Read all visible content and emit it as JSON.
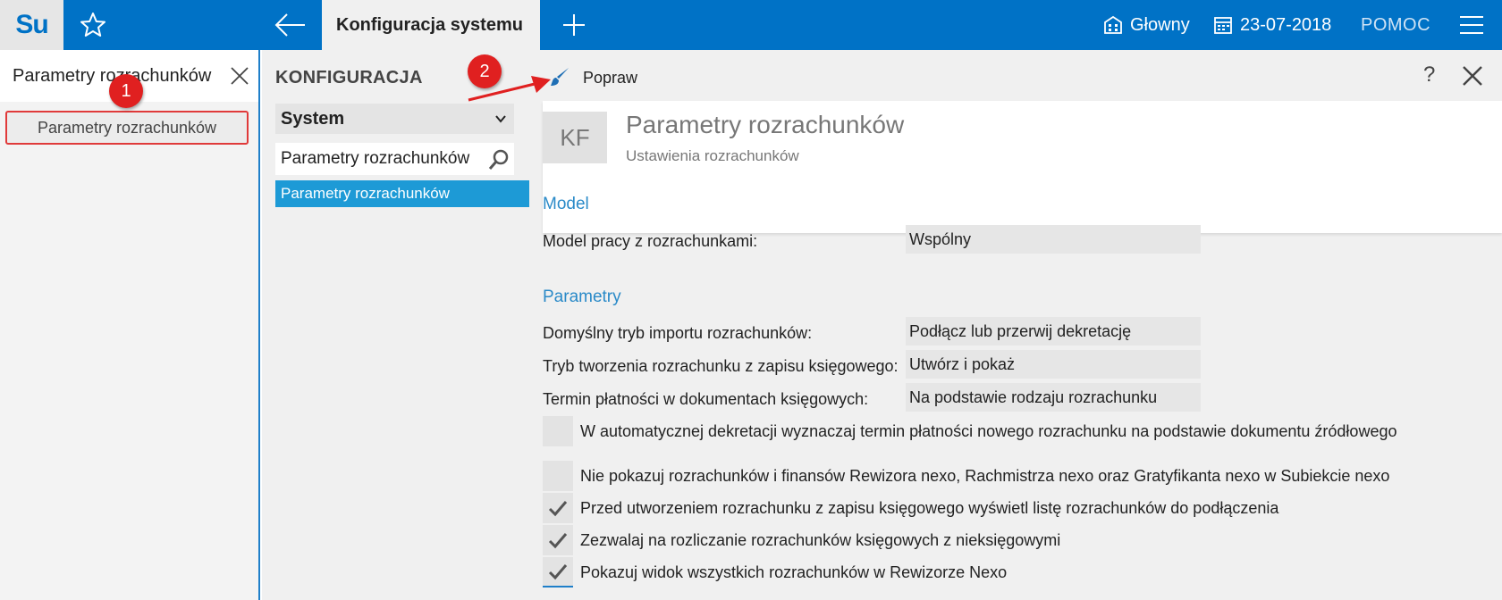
{
  "app": {
    "logo": "Su",
    "active_tab": "Konfiguracja systemu",
    "branch": "Głowny",
    "date": "23-07-2018",
    "help": "POMOC"
  },
  "left_panel": {
    "title": "Parametry rozrachunków",
    "item": "Parametry rozrachunków"
  },
  "middle_panel": {
    "heading": "KONFIGURACJA",
    "select_value": "System",
    "search_value": "Parametry rozrachunków",
    "result": "Parametry rozrachunków"
  },
  "toolbar": {
    "edit_label": "Popraw",
    "help": "?"
  },
  "header": {
    "icon": "KF",
    "title": "Parametry rozrachunków",
    "subtitle": "Ustawienia rozrachunków"
  },
  "sections": {
    "model": "Model",
    "params": "Parametry"
  },
  "fields": [
    {
      "label": "Model pracy z rozrachunkami:",
      "value": "Wspólny"
    },
    {
      "label": "Domyślny tryb importu rozrachunków:",
      "value": "Podłącz lub przerwij dekretację"
    },
    {
      "label": "Tryb tworzenia rozrachunku z zapisu księgowego:",
      "value": "Utwórz i pokaż"
    },
    {
      "label": "Termin płatności w dokumentach księgowych:",
      "value": "Na podstawie rodzaju rozrachunku"
    }
  ],
  "checkboxes": [
    {
      "label": "W automatycznej dekretacji wyznaczaj termin płatności nowego rozrachunku na podstawie dokumentu źródłowego",
      "checked": false
    },
    {
      "label": "Nie pokazuj rozrachunków i finansów Rewizora nexo, Rachmistrza nexo oraz Gratyfikanta nexo w Subiekcie nexo",
      "checked": false
    },
    {
      "label": "Przed utworzeniem rozrachunku z zapisu księgowego wyświetl listę rozrachunków do podłączenia",
      "checked": true
    },
    {
      "label": "Zezwalaj na rozliczanie rozrachunków księgowych z nieksięgowymi",
      "checked": true
    },
    {
      "label": "Pokazuj widok wszystkich rozrachunków w Rewizorze Nexo",
      "checked": true
    }
  ],
  "annotations": {
    "marker1": "1",
    "marker2": "2"
  },
  "colors": {
    "topbar": "#0072c6",
    "accent": "#1d9ad6",
    "section": "#2a8ac8",
    "marker": "#e02020"
  },
  "icons": [
    "star-icon",
    "back-arrow-icon",
    "plus-icon",
    "building-icon",
    "calendar-icon",
    "hamburger-menu-icon",
    "close-icon",
    "chevron-down-icon",
    "search-icon",
    "paintbrush-icon",
    "checkmark-icon"
  ]
}
